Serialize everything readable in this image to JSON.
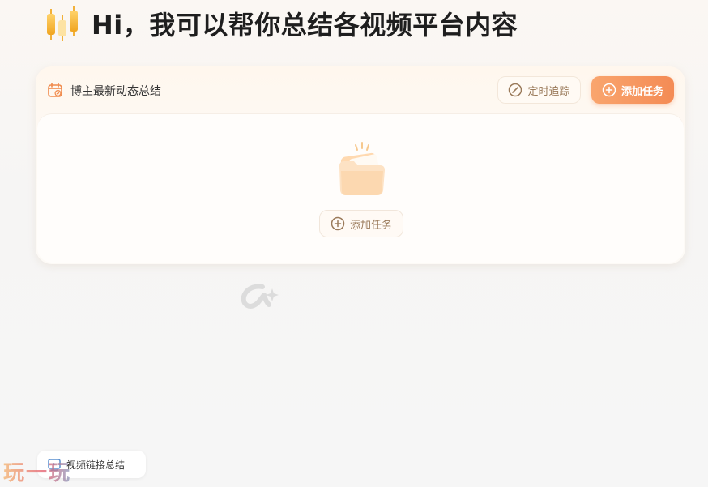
{
  "header": {
    "title": "Hi，我可以帮你总结各视频平台内容",
    "logo_icon": "candlestick-chart-icon"
  },
  "task_card": {
    "title": "博主最新动态总结",
    "title_icon": "calendar-check-icon",
    "timer_button_label": "定时追踪",
    "timer_button_icon": "compass-icon",
    "add_button_label": "添加任务",
    "add_button_icon": "plus-circle-icon",
    "empty_state": {
      "illustration": "folder-sparkle-icon",
      "add_button_label": "添加任务",
      "add_button_icon": "plus-circle-icon"
    }
  },
  "bottom_action": {
    "label": "视频链接总结",
    "icon": "video-link-icon"
  },
  "watermarks": {
    "alpha_icon": "alpha-logo-icon",
    "site_text": "玩一玩"
  },
  "colors": {
    "accent": "#f48b55",
    "accent_light": "#f9a56e",
    "muted_text": "#9a7a5a",
    "logo_gold": "#f2b13a"
  }
}
